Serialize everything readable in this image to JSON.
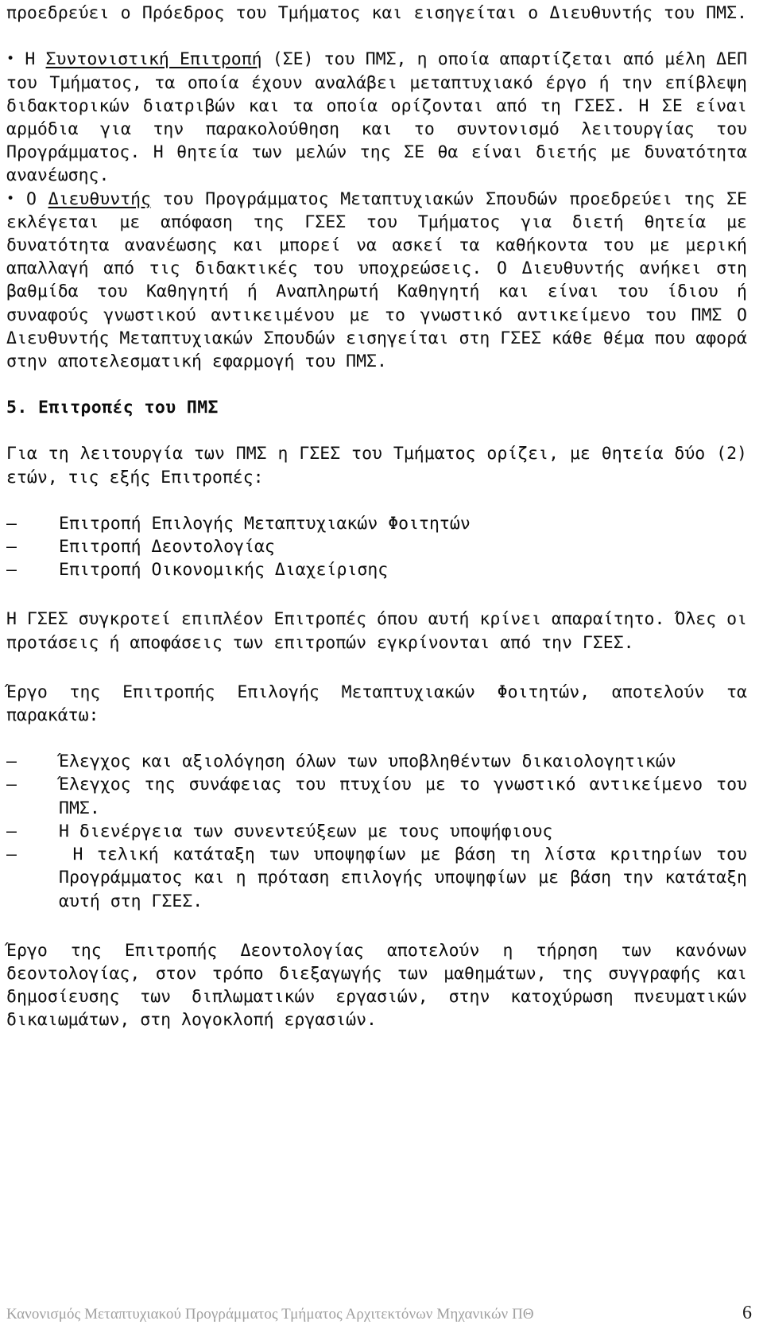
{
  "document": {
    "language": "el",
    "page_number": "6",
    "footer_text": "Κανονισμός Μεταπτυχιακού Προγράμματος Τμήματος Αρχιτεκτόνων Μηχανικών ΠΘ"
  },
  "body": {
    "para_continuation": "προεδρεύει ο Πρόεδρος του Τμήματος και εισηγείται ο Διευθυντής του ΠΜΣ.",
    "bullet_glyph": "•",
    "dash_glyph": "–",
    "clause_se": {
      "lead": "Η ",
      "underlined": "Συντονιστική Επιτροπή",
      "rest": " (ΣΕ) του ΠΜΣ, η οποία απαρτίζεται από μέλη ΔΕΠ του Τμήματος, τα οποία έχουν αναλάβει μεταπτυχιακό έργο ή την επίβλεψη διδακτορικών διατριβών και τα οποία ορίζονται από τη ΓΣΕΣ. Η ΣΕ είναι αρμόδια για την παρακολούθηση και το συντονισμό λειτουργίας του Προγράμματος. Η θητεία των μελών της ΣΕ θα είναι διετής με δυνατότητα ανανέωσης."
    },
    "clause_director": {
      "lead": "Ο ",
      "underlined": "Διευθυντής",
      "rest": " του  Προγράμματος Μεταπτυχιακών Σπουδών προεδρεύει της ΣΕ εκλέγεται με απόφαση της ΓΣΕΣ του Τμήματος για διετή θητεία με δυνατότητα ανανέωσης και μπορεί να ασκεί τα καθήκοντα του με μερική απαλλαγή από τις διδακτικές του υποχρεώσεις. Ο Διευθυντής ανήκει στη βαθμίδα του Καθηγητή ή Αναπληρωτή Καθηγητή και είναι του ίδιου ή συναφούς γνωστικού αντικειμένου με το γνωστικό αντικείμενο του ΠΜΣ Ο Διευθυντής Μεταπτυχιακών Σπουδών εισηγείται στη ΓΣΕΣ κάθε θέμα που αφορά στην αποτελεσματική εφαρμογή του ΠΜΣ."
    },
    "section_heading": "5. Επιτροπές του ΠΜΣ",
    "para_committees_intro": "Για τη λειτουργία των ΠΜΣ η ΓΣΕΣ του Τμήματος ορίζει, με θητεία δύο (2) ετών, τις εξής Επιτροπές:",
    "committees_list": [
      "Επιτροπή Επιλογής Μεταπτυχιακών Φοιτητών",
      "Επιτροπή Δεοντολογίας",
      "Επιτροπή Οικονομικής Διαχείρισης"
    ],
    "para_extra_committees": "Η ΓΣΕΣ συγκροτεί επιπλέον Επιτροπές όπου αυτή κρίνει απαραίτητο. Όλες οι προτάσεις ή αποφάσεις των επιτροπών εγκρίνονται από την ΓΣΕΣ.",
    "para_selection_intro": "Έργο της Επιτροπής Επιλογής Μεταπτυχιακών Φοιτητών, αποτελούν τα παρακάτω:",
    "selection_tasks": [
      "Έλεγχος και αξιολόγηση όλων των υποβληθέντων δικαιολογητικών",
      "Έλεγχος της συνάφειας του πτυχίου με το γνωστικό αντικείμενο του ΠΜΣ.",
      "Η διενέργεια των συνεντεύξεων με τους υποψήφιους",
      " Η τελική κατάταξη των υποψηφίων με βάση τη λίστα κριτηρίων του Προγράμματος και η πρόταση επιλογής υποψηφίων με βάση την κατάταξη αυτή στη ΓΣΕΣ."
    ],
    "para_ethics": "Έργο της Επιτροπής Δεοντολογίας αποτελούν η τήρηση των κανόνων δεοντολογίας, στον τρόπο διεξαγωγής των μαθημάτων, της συγγραφής και δημοσίευσης των διπλωματικών εργασιών, στην κατοχύρωση πνευματικών δικαιωμάτων, στη λογοκλοπή εργασιών."
  }
}
